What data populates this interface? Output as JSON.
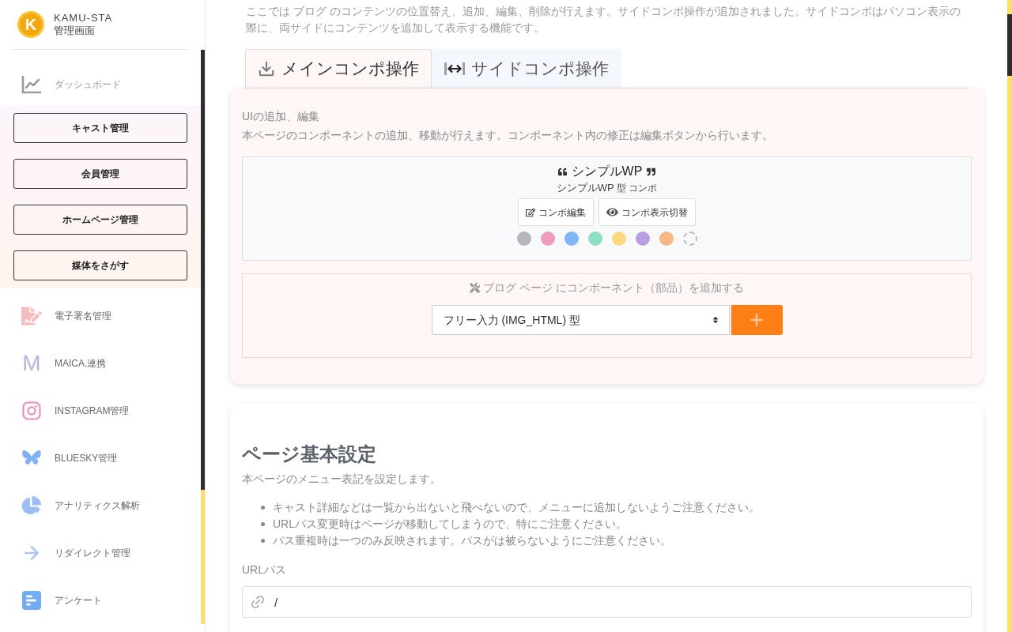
{
  "sidebar": {
    "logo": {
      "mark": "K",
      "title": "KAMU-STA",
      "subtitle": "管理画面"
    },
    "dashboard": {
      "label": "ダッシュボード"
    },
    "menu_buttons": [
      {
        "label": "キャスト管理"
      },
      {
        "label": "会員管理"
      },
      {
        "label": "ホームページ管理"
      },
      {
        "label": "媒体をさがす"
      }
    ],
    "links": [
      {
        "label": "電子署名管理"
      },
      {
        "label": "MAICA.連携",
        "icon_letter": "M"
      },
      {
        "label": "INSTAGRAM管理"
      },
      {
        "label": "BLUESKY管理"
      },
      {
        "label": "アナリティクス解析"
      },
      {
        "label": "リダイレクト管理"
      },
      {
        "label": "アンケート"
      }
    ]
  },
  "main": {
    "intro": "ここでは ブログ のコンテンツの位置替え、追加、編集、削除が行えます。サイドコンポ操作が追加されました。サイドコンポはパソコン表示の際に、両サイドにコンテンツを追加して表示する機能です。",
    "tabs": [
      {
        "label": "メインコンポ操作",
        "selected": true
      },
      {
        "label": "サイドコンポ操作",
        "selected": false
      }
    ],
    "ui_editor": {
      "title": "UIの追加、編集",
      "description": "本ページのコンポーネントの追加、移動が行えます。コンポーネント内の修正は編集ボタンから行います。",
      "component": {
        "name": "シンプルWP",
        "type_name": "シンプルWP",
        "type_suffix": "型 コンポ",
        "buttons": [
          {
            "label": "コンポ編集",
            "kind": "edit"
          },
          {
            "label": "コンポ表示切替",
            "kind": "visibility"
          }
        ],
        "swatches": [
          {
            "kind": "color",
            "color": "#b4b6bb"
          },
          {
            "kind": "color",
            "color": "#f09ac0"
          },
          {
            "kind": "color",
            "color": "#7fb6f7"
          },
          {
            "kind": "color",
            "color": "#8ddfc4"
          },
          {
            "kind": "color",
            "color": "#fbd97c"
          },
          {
            "kind": "color",
            "color": "#b6a0e0"
          },
          {
            "kind": "color",
            "color": "#f7b884"
          },
          {
            "kind": "none"
          }
        ]
      },
      "add_component": {
        "prompt": "ブログ ページ にコンポーネント（部品）を追加する",
        "select": {
          "value": "フリー入力 (IMG_HTML) 型"
        }
      }
    },
    "page_settings": {
      "title": "ページ基本設定",
      "description": "本ページのメニュー表記を設定します。",
      "notes": [
        "キャスト詳細などは一覧から出ないと飛べないので、メニューに追加しないようご注意ください。",
        "URLパス変更時はページが移動してしまうので、特にご注意ください。",
        "パス重複時は一つのみ反映されます。パスがは被らないようにご注意ください。"
      ],
      "url_field": {
        "label": "URLパス",
        "value": "/"
      }
    }
  }
}
